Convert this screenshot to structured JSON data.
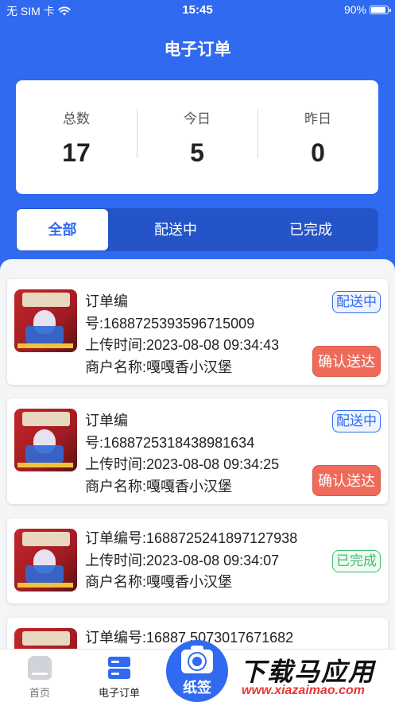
{
  "status_bar": {
    "carrier": "无 SIM 卡",
    "wifi_icon": "wifi-icon",
    "time": "15:45",
    "battery": "90%",
    "battery_level": 0.9
  },
  "header": {
    "title": "电子订单"
  },
  "stats": [
    {
      "label": "总数",
      "value": "17"
    },
    {
      "label": "今日",
      "value": "5"
    },
    {
      "label": "昨日",
      "value": "0"
    }
  ],
  "tabs": [
    {
      "label": "全部",
      "active": true
    },
    {
      "label": "配送中",
      "active": false
    },
    {
      "label": "已完成",
      "active": false
    }
  ],
  "orders": [
    {
      "lines": [
        "订单编",
        "号:1688725393596715009",
        "上传时间:2023-08-08 09:34:43",
        "商户名称:嘎嘎香小汉堡"
      ],
      "status": "配送中",
      "action": "确认送达"
    },
    {
      "lines": [
        "订单编",
        "号:1688725318438981634",
        "上传时间:2023-08-08 09:34:25",
        "商户名称:嘎嘎香小汉堡"
      ],
      "status": "配送中",
      "action": "确认送达"
    },
    {
      "lines": [
        "订单编号:1688725241897127938",
        "上传时间:2023-08-08 09:34:07",
        "商户名称:嘎嘎香小汉堡"
      ],
      "status": "已完成",
      "action": ""
    },
    {
      "lines": [
        "订单编号:16887 5073017671682"
      ],
      "status": "",
      "action": ""
    }
  ],
  "bottom_nav": {
    "home": "首页",
    "orders": "电子订单",
    "camera": "纸签"
  },
  "watermark": {
    "main": "下载马应用",
    "sub": "www.xiazaimao.com"
  },
  "colors": {
    "primary": "#2f6af0",
    "confirm": "#ee6b5b",
    "done": "#3ebd6c"
  }
}
